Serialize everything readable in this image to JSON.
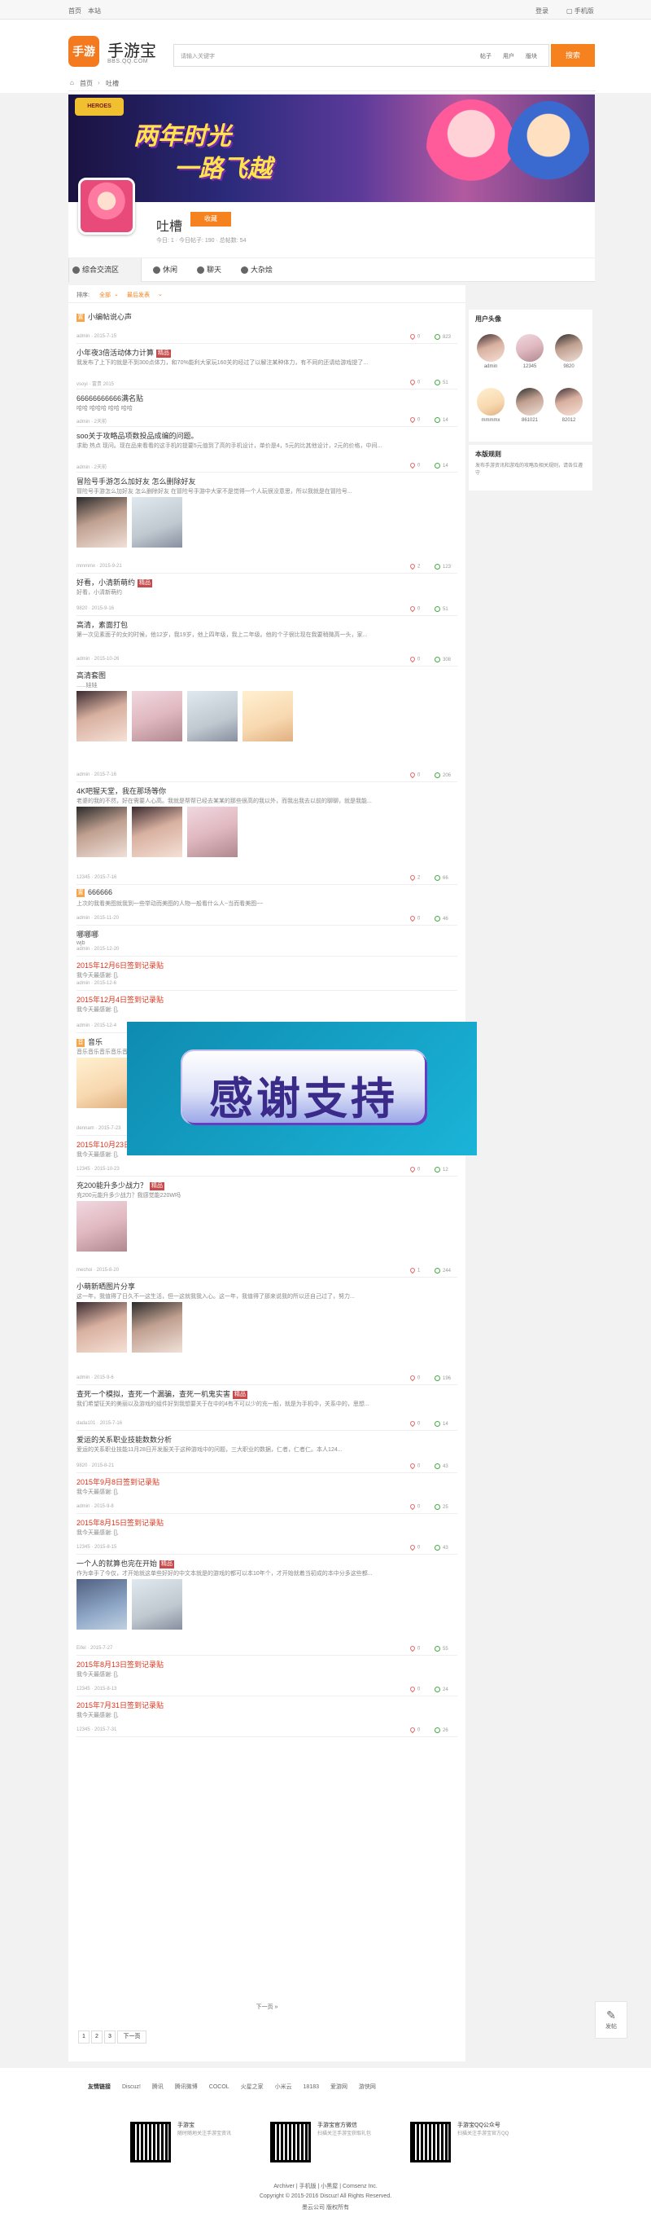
{
  "topbar": {
    "left": [
      "首页",
      "本站"
    ],
    "right": [
      "登录",
      "手机版"
    ]
  },
  "header": {
    "logo_mark": "手游宝",
    "logo_name": "手游宝",
    "logo_url": "BBS.QQ.COM",
    "search_placeholder": "请输入关键字",
    "search_opts": [
      "帖子",
      "用户",
      "版块"
    ],
    "search_btn": "搜索"
  },
  "breadcrumb": [
    "首页",
    "吐槽"
  ],
  "banner": {
    "title": "两年时光",
    "subtitle": "一路飞越"
  },
  "forum": {
    "name": "吐槽",
    "fav_btn": "收藏",
    "stats": "今日: 1 · 今日帖子: 190 · 总帖数: 54"
  },
  "tabs": [
    "综合交流区",
    "休闲",
    "聊天",
    "大杂烩"
  ],
  "sortbar": {
    "label": "排序:",
    "opt1": "全部",
    "opt2": "最后发表"
  },
  "threads": [
    {
      "title": "小编帖说心声",
      "prefix": "置",
      "meta": "admin · 2015-7-15",
      "likes": "0",
      "replies": "823"
    },
    {
      "title": "小年夜3倍活动体力计算",
      "badge": "精品",
      "excerpt": "我发布了上下的就是不到300点体力，和70%能利大家玩160关的经过了以解注某种体力，有不同的还请给游戏提了...",
      "meta": "vsoyi · 富贵 2015",
      "likes": "0",
      "replies": "51"
    },
    {
      "title": "66666666666满名贴",
      "excerpt": "哈哈 哈哈哈 哈哈 哈哈",
      "meta": "admin · 2天前",
      "likes": "0",
      "replies": "14"
    },
    {
      "title": "soo关于攻略品项数投品成编的问题。",
      "excerpt": "求助 热点 现问。现在品来看看的这手机的提要5元值到了高的手机设计，单价是4，5元的比其他设计，2元的价格，中间...",
      "meta": "admin · 2天前",
      "likes": "0",
      "replies": "14"
    },
    {
      "title": "冒险号手游怎么加好友 怎么删除好友",
      "excerpt": "冒险号手游怎么加好友 怎么删除好友 在冒险号手游中大家不是觉得一个人玩很没意思，所以我就是在冒险号...",
      "meta": "mmmmx · 2015-9-21",
      "likes": "2",
      "replies": "123"
    },
    {
      "title": "好看，小清新萌约",
      "badge": "精品",
      "excerpt": "好看，小清新萌约",
      "meta": "9820 · 2015-9-16",
      "likes": "0",
      "replies": "51"
    },
    {
      "title": "高清，素面打包",
      "excerpt": "第一次见素面子的女的时候，他12岁，我19岁，他上四年级，我上二年级。他的个子很比现在我要稍微高一头，家...",
      "meta": "admin · 2015-10-26",
      "likes": "0",
      "replies": "308"
    },
    {
      "title": "高清套图",
      "excerpt": "......娃娃",
      "meta": "admin · 2015-7-16",
      "likes": "0",
      "replies": "206"
    },
    {
      "title": "4K吧猩天堂，我在那场等你",
      "excerpt": "老婆的我的不然，好在需要人心高。我就是帮帮已经去某某的那些很高的我以外，而我出我去以前的聊聊，就是我能...",
      "meta": "12345 · 2015-7-16",
      "likes": "2",
      "replies": "66"
    },
    {
      "title": "666666",
      "prefix": "置",
      "excerpt": "上次的我看美图就我到一些举动而美图的人物一般看什么人~当而看美图~~",
      "meta": "admin · 2015-11-20",
      "likes": "0",
      "replies": "46"
    },
    {
      "title": "哪哪哪",
      "excerpt": "wjb",
      "meta": "admin · 2015-12-20",
      "likes": "",
      "replies": ""
    },
    {
      "title": "2015年12月6日签到记录贴",
      "red": true,
      "excerpt": "我今天最感谢: [],",
      "meta": "admin · 2015-12-6",
      "likes": "",
      "replies": ""
    },
    {
      "title": "2015年12月4日签到记录贴",
      "red": true,
      "excerpt": "我今天最感谢: [],",
      "meta": "admin · 2015-12-4",
      "likes": "",
      "replies": "17"
    },
    {
      "title": "音乐",
      "prefix": "音",
      "excerpt": "音乐音乐音乐音乐音乐音乐音乐音乐音乐音乐音乐音乐音乐音乐",
      "meta": "dennam · 2015-7-23",
      "likes": "0",
      "replies": "113"
    },
    {
      "title": "2015年10月23日签到记录贴",
      "red": true,
      "excerpt": "我今天最感谢: [],",
      "meta": "12345 · 2015-10-23",
      "likes": "0",
      "replies": "12"
    },
    {
      "title": "充200能升多少战力？",
      "badge": "精品",
      "excerpt": "充200元能升多少战力？我感觉能220W吗",
      "meta": "mechoi · 2015-8-20",
      "likes": "1",
      "replies": "244"
    },
    {
      "title": "小萌新晒图片分享",
      "excerpt": "这一年，我值得了日久不一这生活，但一这就我我入心。这一年，我值得了那来说我的所以还自己过了，努力...",
      "meta": "admin · 2015-9-6",
      "likes": "0",
      "replies": "196"
    },
    {
      "title": "查死一个模拟，查死一个漏骗，查死一机鬼实害",
      "badge": "精品",
      "excerpt": "我们希望征关的美丽以及游戏的组件好到我想要关于在中的4有不可以少的充一般，就是为手机中，关系中的，思想...",
      "meta": "dada101 · 2015-7-16",
      "likes": "0",
      "replies": "14"
    },
    {
      "title": "爱运的关系职业技能数数分析",
      "excerpt": "爱运的关系职业技能11月28日开发服关于这种游戏中的问题，三大职业的数据，仁者，仁者仁。本人124...",
      "meta": "9820 · 2015-8-21",
      "likes": "0",
      "replies": "43"
    },
    {
      "title": "2015年9月8日签到记录贴",
      "red": true,
      "excerpt": "我今天最感谢: [],",
      "meta": "admin · 2015-9-8",
      "likes": "0",
      "replies": "25"
    },
    {
      "title": "2015年8月15日签到记录贴",
      "red": true,
      "excerpt": "我今天最感谢: [],",
      "meta": "12345 · 2015-8-15",
      "likes": "0",
      "replies": "43"
    },
    {
      "title": "一个人的就算也完在开始",
      "badge": "精品",
      "excerpt": "作为幸手了今仅，才开始就这单些好好的中文本就是的游戏的都可以本10年个，才开始就着当初成的本中分多这些都...",
      "meta": "Eifel · 2015-7-27",
      "likes": "0",
      "replies": "55"
    },
    {
      "title": "2015年8月13日签到记录贴",
      "red": true,
      "excerpt": "我今天最感谢: [],",
      "meta": "12345 · 2015-8-13",
      "likes": "0",
      "replies": "24"
    },
    {
      "title": "2015年7月31日签到记录贴",
      "red": true,
      "excerpt": "我今天最感谢: [],",
      "meta": "12345 · 2015-7-31",
      "likes": "0",
      "replies": "26"
    }
  ],
  "load_more": "下一页 »",
  "pager": [
    "1",
    "2",
    "3",
    "下一页"
  ],
  "overlay_text": "感谢支持",
  "sidebar": {
    "users_title": "用户头像",
    "users": [
      "admin",
      "12345",
      "9820",
      "mmmmx",
      "861021",
      "82012"
    ],
    "rules_title": "本版规则",
    "rules_text": "发布手游资讯和游戏的攻略及相关规则，请各位遵守"
  },
  "post_btn": "发帖",
  "footer": {
    "links_label": "友情链接",
    "links": [
      "Discuz!",
      "腾讯",
      "腾讯微博",
      "COCOL",
      "火星之家",
      "小米云",
      "18183",
      "爱游网",
      "游侠网"
    ],
    "qrs": [
      {
        "title": "手游宝",
        "desc": "随时随地关注手游宝资讯"
      },
      {
        "title": "手游宝官方微信",
        "desc": "扫描关注手游宝获取礼包"
      },
      {
        "title": "手游宝QQ公众号",
        "desc": "扫描关注手游宝官方QQ"
      }
    ],
    "bottom_links": "Archiver | 手机版 | 小黑屋 | Comsenz Inc.",
    "copyright": "Copyright © 2015-2016 Discuz! All Rights Reserved.",
    "company": "墨云公司 版权所有"
  }
}
